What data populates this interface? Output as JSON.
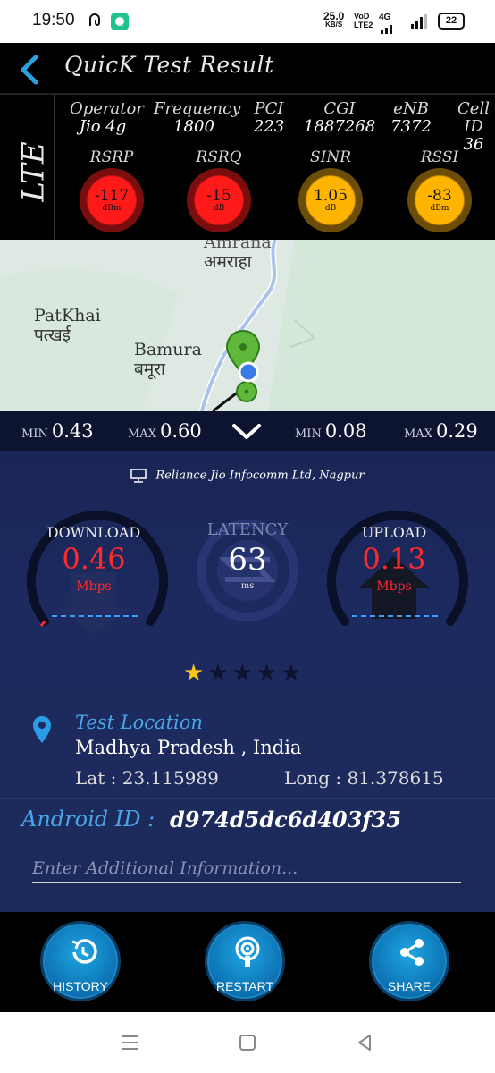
{
  "status_bar": {
    "time": "19:50",
    "net_speed": "25.0",
    "net_unit": "KB/S",
    "volte_1": "VoD",
    "volte_2": "LTE2",
    "signal_label": "4G",
    "battery": "22"
  },
  "header": {
    "title": "QuicK Test Result"
  },
  "lte": {
    "tech_label": "LTE",
    "info": [
      {
        "label": "Operator",
        "value": "Jio 4g"
      },
      {
        "label": "Frequency",
        "value": "1800"
      },
      {
        "label": "PCI",
        "value": "223"
      },
      {
        "label": "CGI",
        "value": "1887268"
      },
      {
        "label": "eNB",
        "value": "7372"
      },
      {
        "label": "Cell ID",
        "value": "36"
      }
    ],
    "gauges": [
      {
        "label": "RSRP",
        "value": "-117",
        "unit": "dBm",
        "status": "red"
      },
      {
        "label": "RSRQ",
        "value": "-15",
        "unit": "dB",
        "status": "red"
      },
      {
        "label": "SINR",
        "value": "1.05",
        "unit": "dB",
        "status": "orange"
      },
      {
        "label": "RSSI",
        "value": "-83",
        "unit": "dBm",
        "status": "orange"
      }
    ]
  },
  "map": {
    "places": [
      {
        "en": "Amrana",
        "hi": "अमराहा"
      },
      {
        "en": "PatKhai",
        "hi": "पत्खई"
      },
      {
        "en": "Bamura",
        "hi": "बमूरा"
      }
    ]
  },
  "stats": {
    "download_min_label": "MIN",
    "download_min": "0.43",
    "download_max_label": "MAX",
    "download_max": "0.60",
    "upload_min_label": "MIN",
    "upload_min": "0.08",
    "upload_max_label": "MAX",
    "upload_max": "0.29"
  },
  "isp": "Reliance Jio Infocomm Ltd, Nagpur",
  "download": {
    "label": "DOWNLOAD",
    "value": "0.46",
    "unit": "Mbps"
  },
  "latency": {
    "label": "LATENCY",
    "value": "63",
    "unit": "ms"
  },
  "upload": {
    "label": "UPLOAD",
    "value": "0.13",
    "unit": "Mbps"
  },
  "rating": {
    "value": 1,
    "max": 5
  },
  "location": {
    "title": "Test Location",
    "place": "Madhya Pradesh , India",
    "lat_text": "Lat : 23.115989",
    "long_text": "Long : 81.378615"
  },
  "android_id": {
    "label": "Android ID :",
    "value": "d974d5dc6d403f35"
  },
  "extra_info": {
    "placeholder": "Enter Additional Information..."
  },
  "actions": {
    "history": "HISTORY",
    "restart": "RESTART",
    "share": "SHARE"
  },
  "colors": {
    "accent_blue": "#4aa6e8",
    "alert_red": "#ff1a1a",
    "warn_orange": "#ffb400",
    "button_blue": "#0b6fb1"
  }
}
